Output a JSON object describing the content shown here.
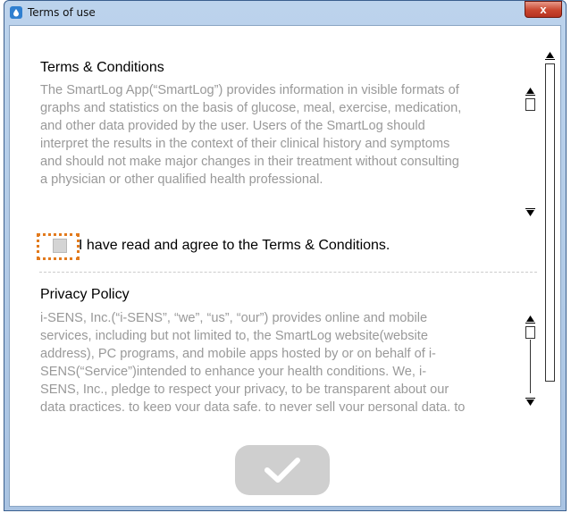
{
  "window": {
    "title": "Terms of use",
    "close_label": "x"
  },
  "terms": {
    "heading": "Terms & Conditions",
    "lines": [
      "The SmartLog App(“SmartLog”) provides information in visible formats of",
      "graphs and statistics on the basis of glucose, meal, exercise, medication,",
      "and other data provided by the user. Users of the SmartLog should",
      "interpret the results in the context of their clinical history and symptoms",
      "and should not make major changes in their treatment without consulting",
      "a physician or other qualified health professional."
    ]
  },
  "agreement": {
    "label": "I have read and agree to the Terms & Conditions.",
    "checked": false
  },
  "privacy": {
    "heading": "Privacy Policy",
    "lines": [
      "i-SENS, Inc.(“i-SENS”, “we”, “us”, “our”) provides online and mobile",
      "services, including but not limited to, the SmartLog website(website",
      "address), PC programs, and mobile apps hosted by or on behalf of i-",
      "SENS(“Service”)intended to enhance your health conditions. We, i-",
      "SENS, Inc., pledge to respect your privacy, to be transparent about our",
      "data practices, to keep your data safe, to never sell your personal data, to"
    ]
  },
  "confirm": {
    "icon": "checkmark-icon",
    "enabled": false
  }
}
